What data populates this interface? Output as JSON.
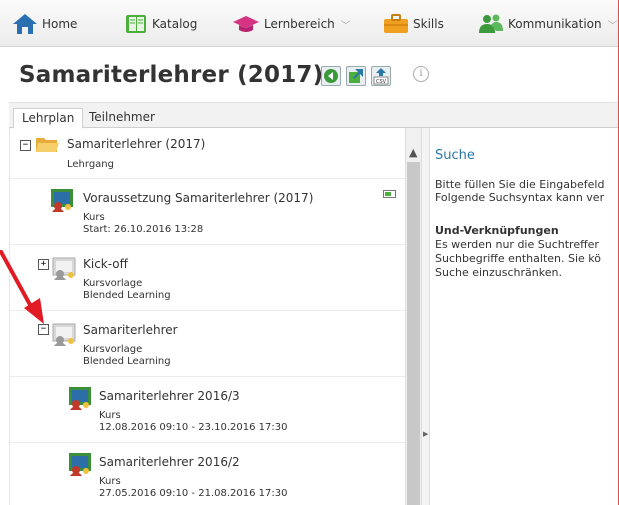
{
  "nav": {
    "home": "Home",
    "katalog": "Katalog",
    "lernbereich": "Lernbereich",
    "skills": "Skills",
    "kommunikation": "Kommunikation",
    "chevron": "﹀"
  },
  "title": {
    "text": "Samariterlehrer (2017)",
    "info": "i"
  },
  "tabs": [
    "Lehrplan",
    "Teilnehmer"
  ],
  "tree": {
    "root": {
      "title": "Samariterlehrer (2017)",
      "type": "Lehrgang"
    },
    "items": [
      {
        "title": "Voraussetzung Samariterlehrer (2017)",
        "line1": "Kurs",
        "line2": "Start: 26.10.2016 13:28"
      },
      {
        "title": "Kick-off",
        "line1": "Kursvorlage",
        "line2": "Blended Learning"
      },
      {
        "title": "Samariterlehrer",
        "line1": "Kursvorlage",
        "line2": "Blended Learning"
      },
      {
        "title": "Samariterlehrer 2016/3",
        "line1": "Kurs",
        "line2": "12.08.2016 09:10 - 23.10.2016 17:30"
      },
      {
        "title": "Samariterlehrer 2016/2",
        "line1": "Kurs",
        "line2": "27.05.2016 09:10 - 21.08.2016 17:30"
      }
    ]
  },
  "search": {
    "title": "Suche",
    "intro1": "Bitte füllen Sie die Eingabefeld",
    "intro2": "Folgende Suchsyntax kann ver",
    "heading": "Und-Verknüpfungen",
    "text1": "Es werden nur die Suchtreffer",
    "text2": "Suchbegriffe enthalten. Sie kö",
    "text3": "Suche einzuschränken."
  },
  "colors": {
    "accent": "#2a78a8",
    "annotation": "#e01b24",
    "folder": "#f2c35a",
    "home_icon": "#2a6fb0",
    "katalog_icon": "#4caf3c",
    "lernbereich_icon": "#d63384",
    "skills_icon": "#f0a020",
    "kommunikation_icon": "#3c9a3c"
  }
}
